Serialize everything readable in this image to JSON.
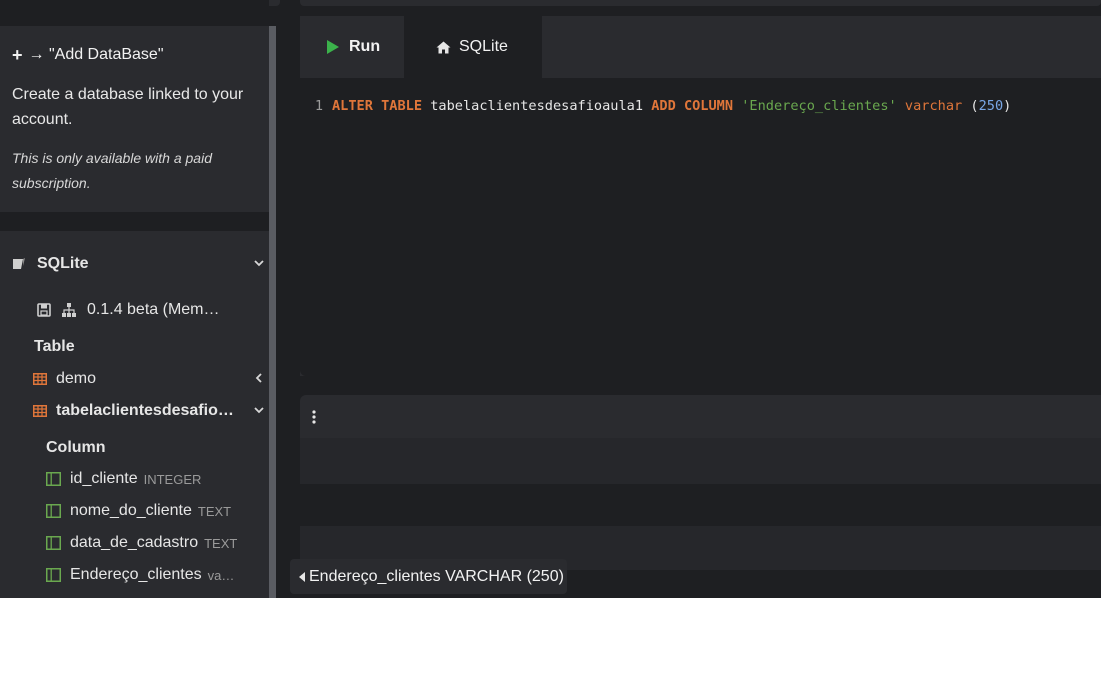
{
  "add_database": {
    "title": "→ \"Add DataBase\"",
    "description": "Create a database linked to your account.",
    "note": "This is only available with a paid subscription."
  },
  "sidebar": {
    "engine_label": "SQLite",
    "version_label": "0.1.4 beta (Mem…",
    "table_header": "Table",
    "tables": [
      {
        "name": "demo",
        "expanded": false
      },
      {
        "name": "tabelaclientesdesafio…",
        "expanded": true
      }
    ],
    "column_header": "Column",
    "columns": [
      {
        "name": "id_cliente",
        "type": "INTEGER"
      },
      {
        "name": "nome_do_cliente",
        "type": "TEXT"
      },
      {
        "name": "data_de_cadastro",
        "type": "TEXT"
      },
      {
        "name": "Endereço_clientes",
        "type": "va…"
      }
    ]
  },
  "toolbar": {
    "run_label": "Run",
    "tab_label": "SQLite"
  },
  "editor": {
    "line_number": "1",
    "tokens": {
      "kw1": "ALTER TABLE",
      "table": "tabelaclientesdesafioaula1",
      "kw2": "ADD COLUMN",
      "column": "'Endereço_clientes'",
      "type": "varchar",
      "open": "(",
      "size": "250",
      "close": ")"
    }
  },
  "tooltip": {
    "text": "Endereço_clientes VARCHAR (250)"
  },
  "colors": {
    "run_icon": "#3bb24b",
    "table_icon": "#e0763a",
    "column_icon": "#6aa84f",
    "keyword": "#e0763a"
  }
}
